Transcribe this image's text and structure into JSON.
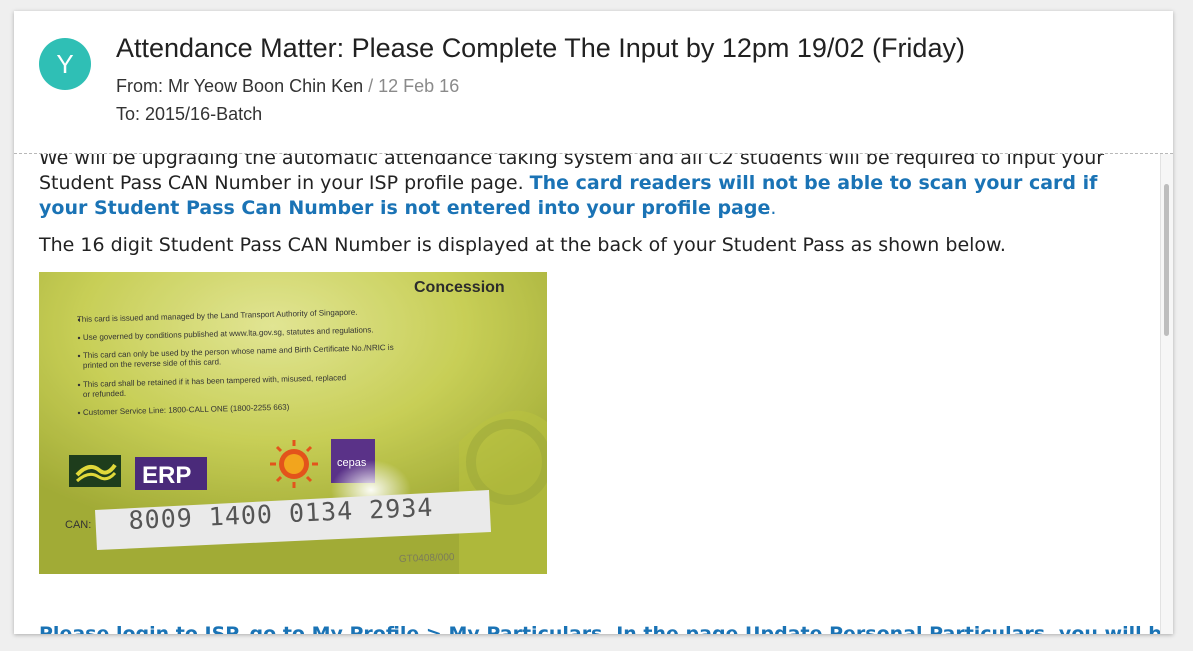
{
  "email": {
    "avatar_letter": "Y",
    "avatar_color": "#2fbfb5",
    "subject": "Attendance Matter: Please Complete The Input by 12pm 19/02 (Friday)",
    "from_label": "From: ",
    "from_name": "Mr Yeow Boon Chin Ken",
    "date": " / 12 Feb 16",
    "to_label": "To: ",
    "to_value": "2015/16-Batch"
  },
  "body": {
    "p1_text": "We will be upgrading the automatic attendance taking system and all C2 students will be required to input your Student Pass CAN Number in your ISP profile page. ",
    "p1_highlight": "The card readers will not be able to scan your card if your Student Pass Can Number is not entered into your profile page",
    "p1_end": ".",
    "p2_text": "The 16 digit Student Pass CAN Number is displayed at the back of your Student Pass as shown below.",
    "p3_text": "Please login to ISP, go to My Profile > My Particulars. In the page Update Personal Particulars, you will be able t",
    "accent_color": "#1a73b5"
  },
  "card": {
    "title": "Concession",
    "bullets": [
      "This card is issued and managed by the Land Transport Authority of Singapore.",
      "Use governed by conditions published at www.lta.gov.sg, statutes and regulations.",
      "This card can only be used by the person whose name and Birth Certificate No./NRIC is",
      "printed on the reverse side of this card.",
      "This card shall be retained if it has been tampered with, misused, replaced",
      "or refunded.",
      "Customer Service Line: 1800-CALL ONE (1800-2255 663)"
    ],
    "erp_label": "ERP",
    "cepas_label": "cepas",
    "can_label": "CAN:",
    "can_number": "8009 1400 0134 2934",
    "serial": "GT0408/000"
  }
}
